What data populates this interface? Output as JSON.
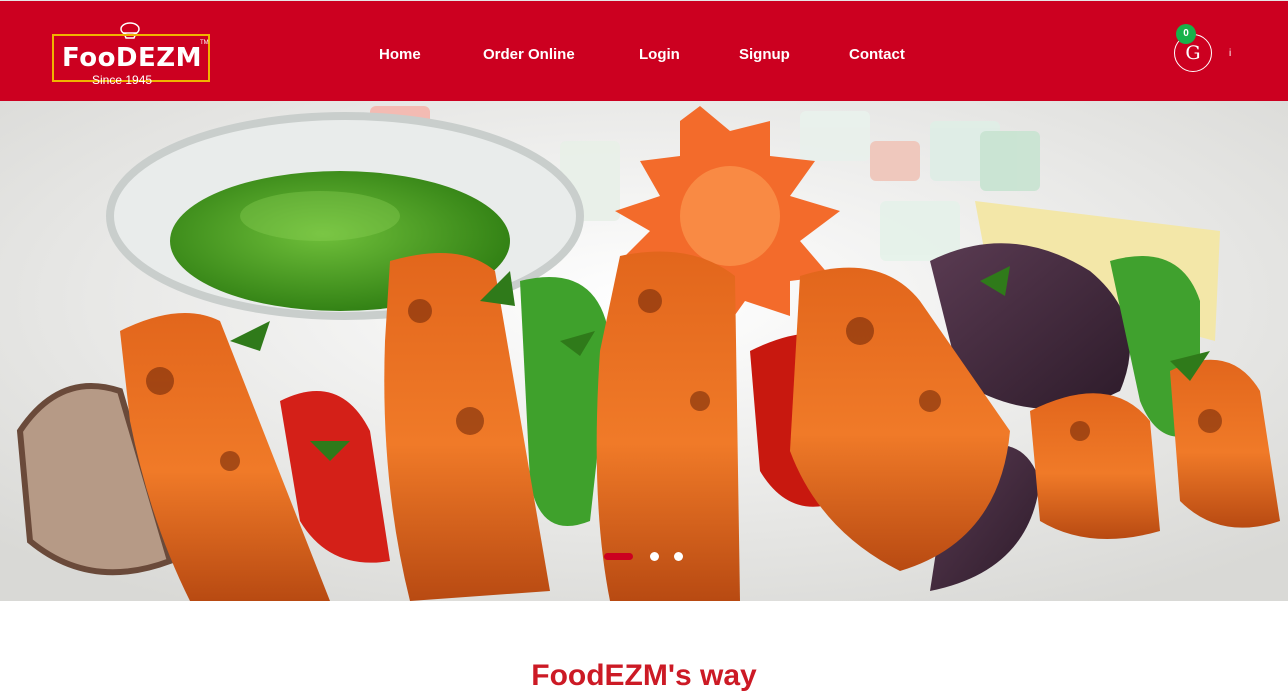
{
  "brand": {
    "name": "FooDEZM",
    "trademark": "TM",
    "tagline": "Since 1945"
  },
  "nav": {
    "items": [
      {
        "label": "Home"
      },
      {
        "label": "Order Online"
      },
      {
        "label": "Login"
      },
      {
        "label": "Signup"
      },
      {
        "label": "Contact"
      }
    ]
  },
  "account": {
    "avatar_initial": "G",
    "cart_count": "0",
    "more_label": "i"
  },
  "carousel": {
    "slide_count": 3,
    "active_index": 0,
    "image": "paneer-tikka-platter"
  },
  "section": {
    "heading": "FoodEZM's way"
  },
  "colors": {
    "brand_red": "#cc0020",
    "logo_border": "#f0b400",
    "badge_green": "#17b24a",
    "heading_red": "#cc1a25"
  }
}
